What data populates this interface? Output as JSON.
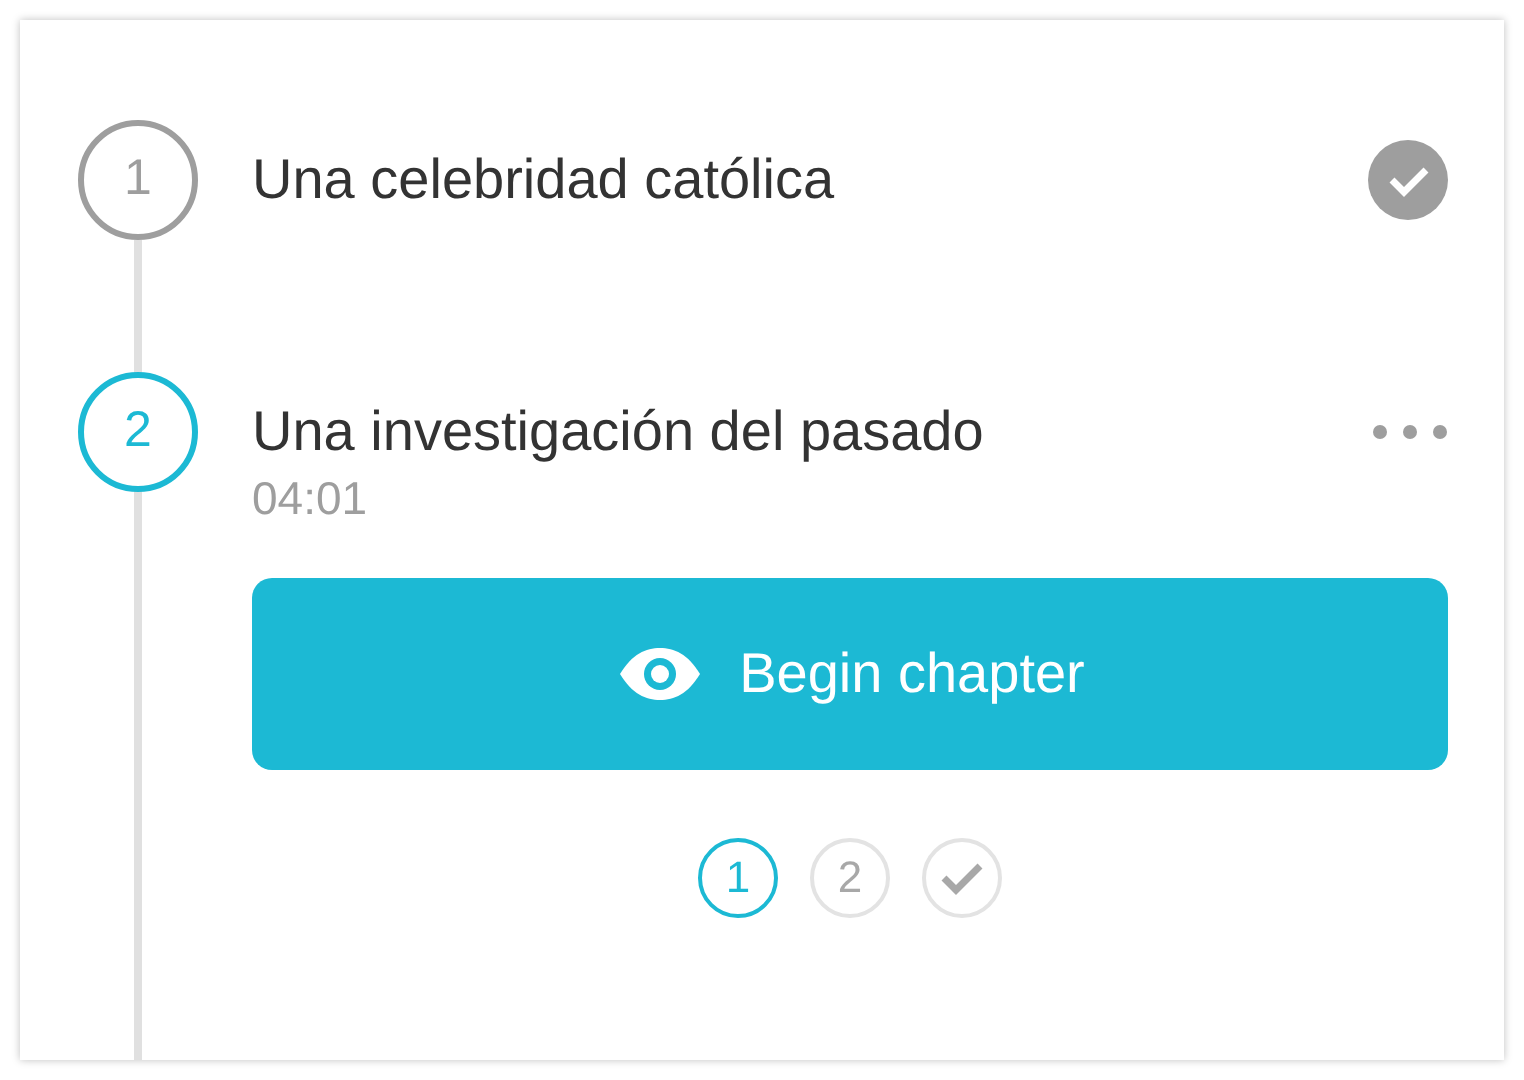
{
  "chapters": [
    {
      "number": "1",
      "title": "Una celebridad católica",
      "completed": true,
      "current": false
    },
    {
      "number": "2",
      "title": "Una investigación del pasado",
      "completed": false,
      "current": true,
      "duration": "04:01",
      "button": "Begin chapter",
      "steps": [
        {
          "kind": "number",
          "label": "1",
          "selected": true
        },
        {
          "kind": "number",
          "label": "2",
          "selected": false
        },
        {
          "kind": "check",
          "selected": false
        }
      ]
    }
  ]
}
